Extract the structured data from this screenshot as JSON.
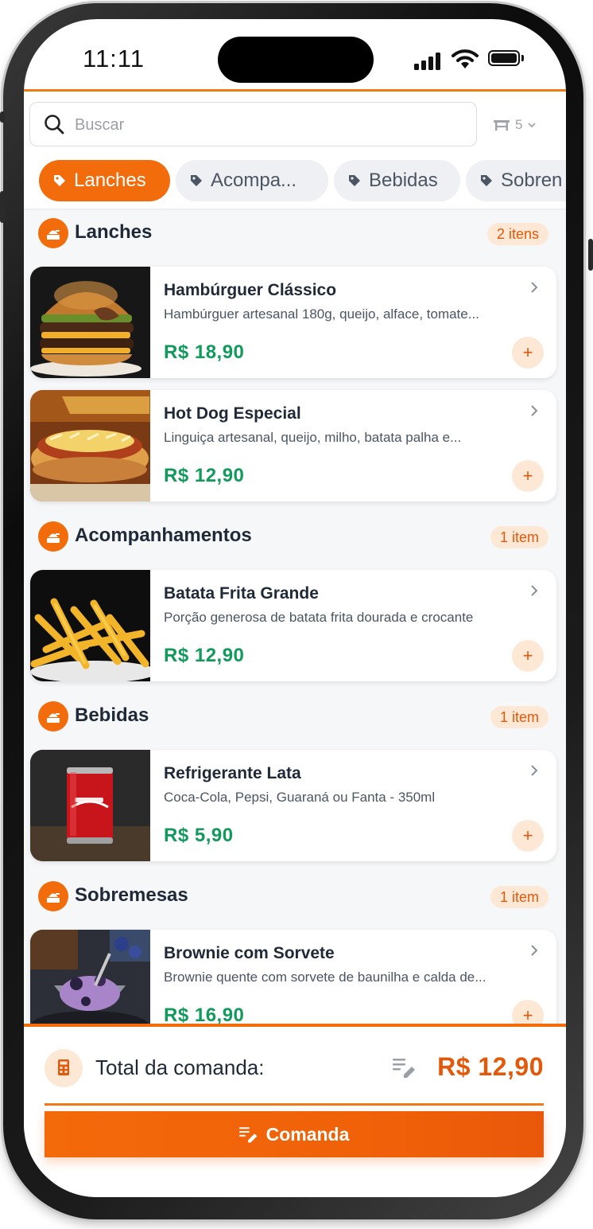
{
  "status": {
    "time": "11:11"
  },
  "search": {
    "placeholder": "Buscar",
    "table_number": "5"
  },
  "categories": [
    {
      "label": "Lanches",
      "active": true
    },
    {
      "label": "Acompa...",
      "active": false
    },
    {
      "label": "Bebidas",
      "active": false
    },
    {
      "label": "Sobren",
      "active": false
    }
  ],
  "sections": [
    {
      "title": "Lanches",
      "badge": "2 itens",
      "items": [
        {
          "name": "Hambúrguer Clássico",
          "description": "Hambúrguer artesanal 180g, queijo, alface, tomate...",
          "price": "R$  18,90",
          "image": "burger"
        },
        {
          "name": "Hot Dog Especial",
          "description": "Linguiça artesanal, queijo, milho, batata palha e...",
          "price": "R$  12,90",
          "image": "hotdog"
        }
      ]
    },
    {
      "title": "Acompanhamentos",
      "badge": "1 item",
      "items": [
        {
          "name": "Batata Frita Grande",
          "description": "Porção generosa de batata frita dourada e crocante",
          "price": "R$  12,90",
          "image": "fries"
        }
      ]
    },
    {
      "title": "Bebidas",
      "badge": "1 item",
      "items": [
        {
          "name": "Refrigerante Lata",
          "description": "Coca-Cola, Pepsi, Guaraná ou Fanta - 350ml",
          "price": "R$  5,90",
          "image": "soda"
        }
      ]
    },
    {
      "title": "Sobremesas",
      "badge": "1 item",
      "items": [
        {
          "name": "Brownie com Sorvete",
          "description": "Brownie quente com sorvete de baunilha e calda de...",
          "price": "R$  16,90",
          "image": "dessert"
        }
      ]
    }
  ],
  "add_label": "+",
  "footer": {
    "total_label": "Total da comanda:",
    "total_value": "R$  12,90",
    "button_label": "Comanda"
  },
  "colors": {
    "accent": "#f36c0c",
    "price": "#119a5b",
    "badge_bg": "#fde8d6"
  },
  "icons": {
    "search": "search-icon",
    "table": "table-icon",
    "tag": "tag-icon",
    "section": "food-tray-icon",
    "add": "plus-icon",
    "calculator": "calculator-icon",
    "edit": "edit-list-icon"
  }
}
